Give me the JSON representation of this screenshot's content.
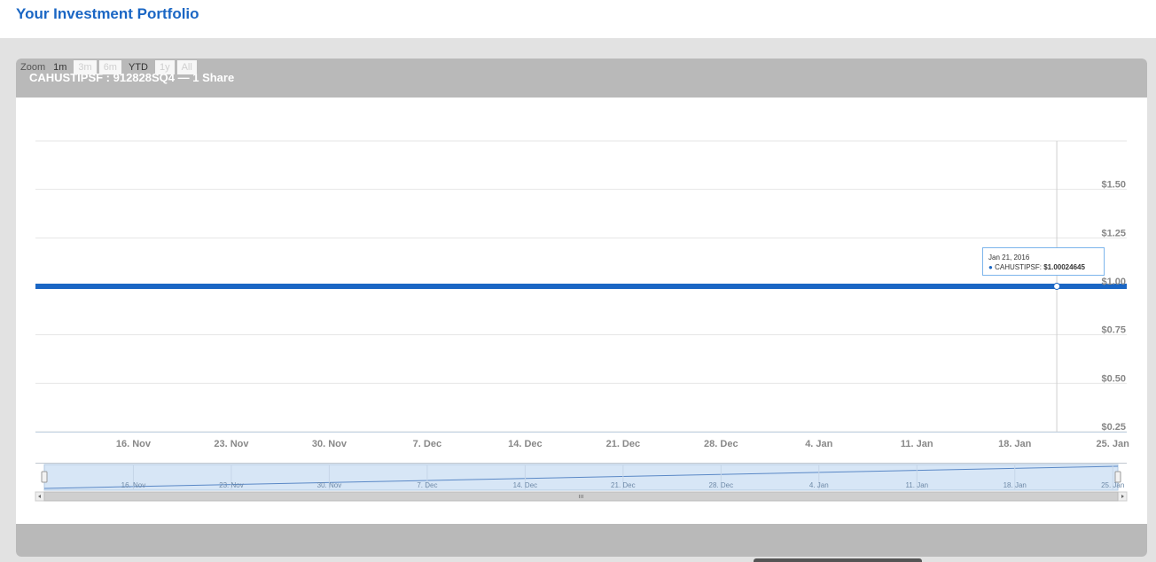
{
  "page": {
    "title": "Your Investment Portfolio"
  },
  "panel": {
    "title": "CAHUSTIPSF : 912828SQ4 — 1 Share"
  },
  "zoom": {
    "label": "Zoom",
    "buttons": [
      {
        "label": "1m",
        "enabled": true
      },
      {
        "label": "3m",
        "enabled": false
      },
      {
        "label": "6m",
        "enabled": false
      },
      {
        "label": "YTD",
        "enabled": true
      },
      {
        "label": "1y",
        "enabled": false
      },
      {
        "label": "All",
        "enabled": false
      }
    ]
  },
  "tooltip": {
    "date": "Jan 21, 2016",
    "bullet": "●",
    "series": "CAHUSTIPSF",
    "value": "$1.00024645"
  },
  "colors": {
    "series": "#1a66c4",
    "title": "#1a66c4",
    "panel_header": "#b9b9b9"
  },
  "chart_data": {
    "type": "line",
    "series": [
      {
        "name": "CAHUSTIPSF",
        "points": [
          {
            "x": "2015-11-12",
            "y": 1.0
          },
          {
            "x": "2016-01-21",
            "y": 1.00024645
          },
          {
            "x": "2016-01-26",
            "y": 1.0
          }
        ]
      }
    ],
    "x_start": "2015-11-09",
    "x_end": "2016-01-26",
    "x_ticks": [
      {
        "label": "16. Nov",
        "date": "2015-11-16"
      },
      {
        "label": "23. Nov",
        "date": "2015-11-23"
      },
      {
        "label": "30. Nov",
        "date": "2015-11-30"
      },
      {
        "label": "7. Dec",
        "date": "2015-12-07"
      },
      {
        "label": "14. Dec",
        "date": "2015-12-14"
      },
      {
        "label": "21. Dec",
        "date": "2015-12-21"
      },
      {
        "label": "28. Dec",
        "date": "2015-12-28"
      },
      {
        "label": "4. Jan",
        "date": "2016-01-04"
      },
      {
        "label": "11. Jan",
        "date": "2016-01-11"
      },
      {
        "label": "18. Jan",
        "date": "2016-01-18"
      },
      {
        "label": "25. Jan",
        "date": "2016-01-25"
      }
    ],
    "y_ticks": [
      {
        "label": "$1.50",
        "value": 1.5
      },
      {
        "label": "$1.25",
        "value": 1.25
      },
      {
        "label": "$1.00",
        "value": 1.0
      },
      {
        "label": "$0.75",
        "value": 0.75
      },
      {
        "label": "$0.50",
        "value": 0.5
      },
      {
        "label": "$0.25",
        "value": 0.25
      }
    ],
    "ylim": [
      0.25,
      1.75
    ],
    "grid": true,
    "crosshair_date": "2016-01-21",
    "navigator": {
      "x_ticks": [
        "16. Nov",
        "23. Nov",
        "30. Nov",
        "7. Dec",
        "14. Dec",
        "21. Dec",
        "28. Dec",
        "4. Jan",
        "11. Jan",
        "18. Jan",
        "25. Jan"
      ]
    }
  }
}
